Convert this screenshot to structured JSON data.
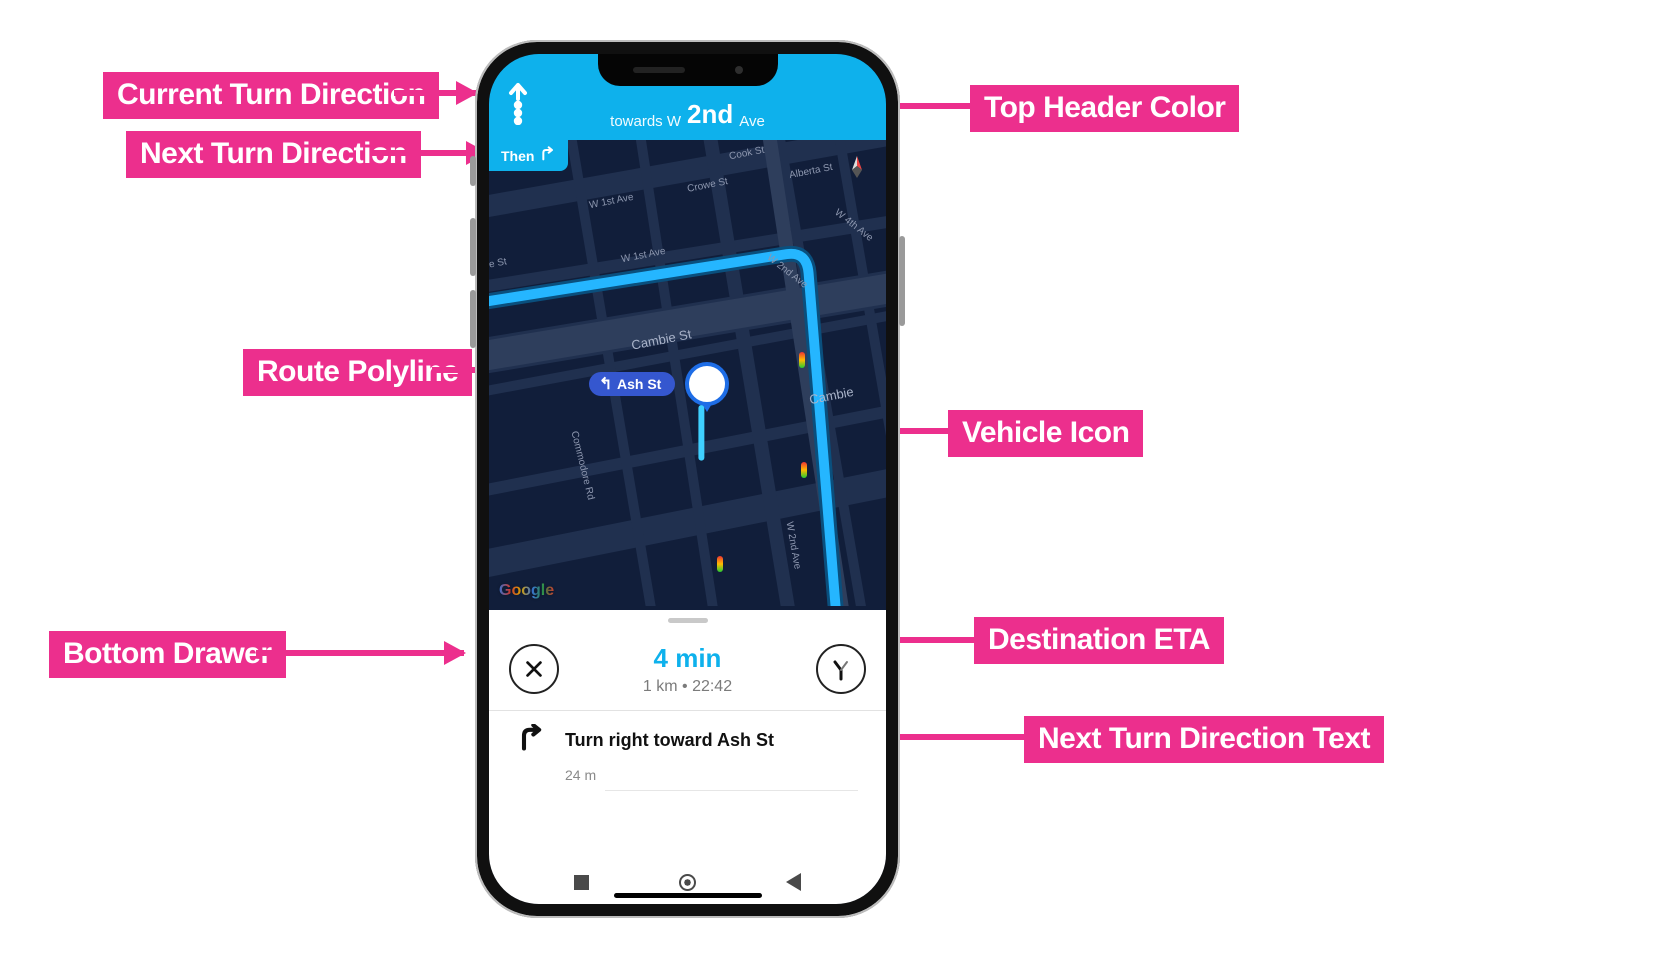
{
  "labels": {
    "top_left": "Current Turn Direction",
    "mid_left_1": "Next Turn Direction",
    "mid_left_2": "Route Polyline",
    "bottom_left": "Bottom Drawer",
    "top_right": "Top Header Color",
    "mid_right_1": "Vehicle Icon",
    "mid_right_2": "Destination ETA",
    "bottom_right": "Next Turn Direction Text"
  },
  "header": {
    "towards_prefix": "towards W",
    "street_big": "2nd",
    "street_suffix": "Ave",
    "color": "#0eb1ec",
    "current_turn_icon": "straight-dotted-icon"
  },
  "then_chip": {
    "label": "Then",
    "icon": "right-turn-icon"
  },
  "map": {
    "streets": [
      "Cook St",
      "Alberta St",
      "W 1st Ave",
      "Crowe St",
      "W 1st Ave",
      "e St",
      "W 2nd Ave",
      "W 4th Ave",
      "Cambie St",
      "Cambie",
      "Commodore Rd",
      "W 2nd Ave"
    ],
    "ash_pill": "Ash St",
    "attribution": "Google",
    "polyline_color": "#1fb3ff"
  },
  "drawer": {
    "eta": "4 min",
    "eta_sub_distance": "1 km",
    "eta_sub_time": "22:42",
    "next_turn_title": "Turn right toward Ash St",
    "next_turn_distance": "24 m",
    "close_icon": "x-icon",
    "route_icon": "fork-icon",
    "next_turn_icon": "right-turn-icon"
  },
  "colors": {
    "callout": "#ec2f8d"
  }
}
